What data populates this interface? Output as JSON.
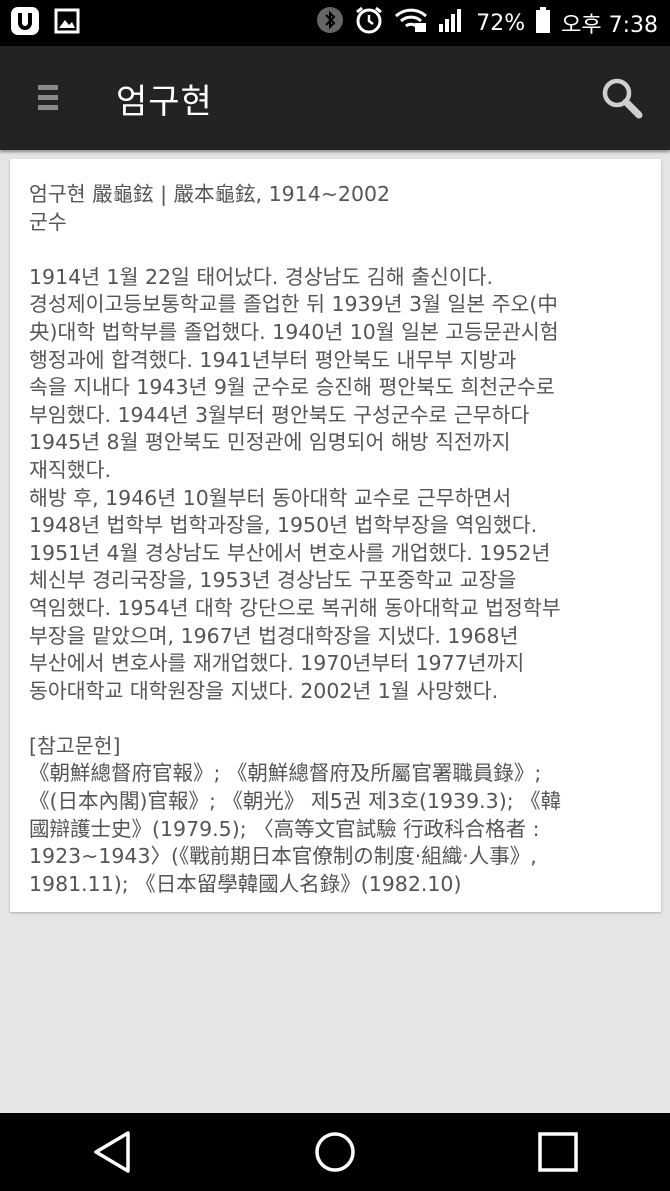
{
  "status_bar": {
    "battery_percent": "72%",
    "time": "오후 7:38"
  },
  "app_bar": {
    "title": "엄구현"
  },
  "article": {
    "heading": "엄구현 嚴龜鉉 | 嚴本龜鉉, 1914~2002",
    "role": "군수",
    "paragraph_1": "1914년 1월 22일 태어났다. 경상남도 김해 출신이다.\n경성제이고등보통학교를 졸업한 뒤 1939년 3월 일본 주오(中\n央)대학 법학부를 졸업했다. 1940년 10월 일본 고등문관시험\n행정과에 합격했다. 1941년부터 평안북도 내무부 지방과\n속을 지내다 1943년 9월 군수로 승진해 평안북도 희천군수로\n부임했다. 1944년 3월부터 평안북도 구성군수로 근무하다\n1945년 8월 평안북도 민정관에 임명되어 해방 직전까지\n재직했다.",
    "paragraph_2": "해방 후, 1946년 10월부터 동아대학 교수로 근무하면서\n1948년 법학부 법학과장을, 1950년 법학부장을 역임했다.\n1951년 4월 경상남도 부산에서 변호사를 개업했다. 1952년\n체신부 경리국장을, 1953년 경상남도 구포중학교 교장을\n역임했다. 1954년 대학 강단으로 복귀해 동아대학교 법정학부\n부장을 맡았으며, 1967년 법경대학장을 지냈다. 1968년\n부산에서 변호사를 재개업했다. 1970년부터 1977년까지\n동아대학교 대학원장을 지냈다. 2002년 1월 사망했다.",
    "references_title": "[참고문헌]",
    "references": "《朝鮮總督府官報》; 《朝鮮總督府及所屬官署職員錄》;\n《(日本內閣)官報》; 《朝光》 제5권 제3호(1939.3); 《韓\n國辯護士史》(1979.5); 〈高等文官試驗 行政科合格者 :\n1923~1943〉(《戰前期日本官僚制の制度·組織·人事》,\n1981.11); 《日本留學韓國人名錄》(1982.10)"
  },
  "colors": {
    "status_bar": "#000000",
    "app_bar": "#232323",
    "background": "#e5e5e5",
    "card": "#ffffff",
    "text": "#555555"
  }
}
